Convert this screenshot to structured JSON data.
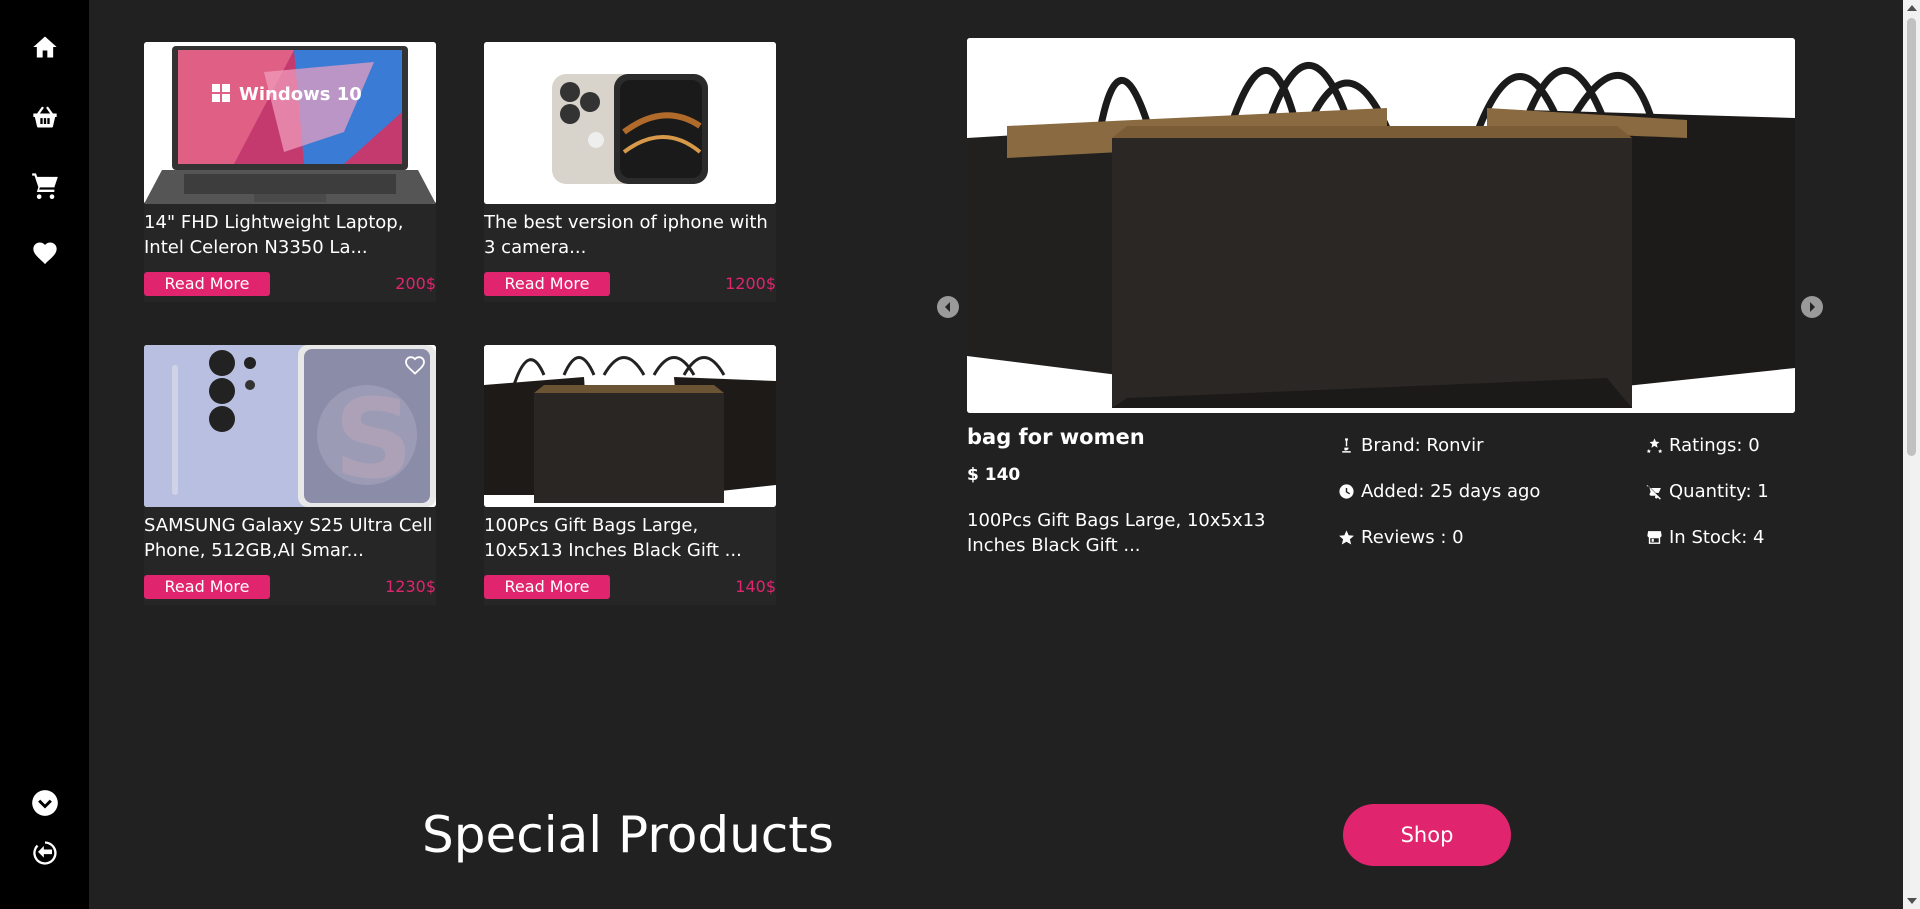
{
  "sidebar": {
    "icons": [
      "home-icon",
      "basket-icon",
      "cart-icon",
      "heart-icon",
      "chevron-down-icon",
      "logout-icon"
    ]
  },
  "products": [
    {
      "title": "14\" FHD Lightweight Laptop, Intel Celeron N3350 La...",
      "read_more": "Read More",
      "price": "200$",
      "image_text": "Windows 10"
    },
    {
      "title": "The best version of iphone with 3 camera...",
      "read_more": "Read More",
      "price": "1200$"
    },
    {
      "title": "SAMSUNG Galaxy S25 Ultra Cell Phone, 512GB,AI Smar...",
      "read_more": "Read More",
      "price": "1230$"
    },
    {
      "title": "100Pcs Gift Bags Large, 10x5x13 Inches Black Gift ...",
      "read_more": "Read More",
      "price": "140$"
    }
  ],
  "featured": {
    "title": "bag for women",
    "price": "$ 140",
    "description": "100Pcs Gift Bags Large, 10x5x13 Inches Black Gift ...",
    "brand": "Brand: Ronvir",
    "added": "Added: 25 days ago",
    "reviews": "Reviews : 0",
    "ratings": "Ratings: 0",
    "quantity": "Quantity: 1",
    "in_stock": "In Stock: 4"
  },
  "special": {
    "title": "Special Products",
    "shop_label": "Shop"
  },
  "colors": {
    "accent": "#e0246e",
    "background": "#212121",
    "sidebar": "#000000"
  }
}
